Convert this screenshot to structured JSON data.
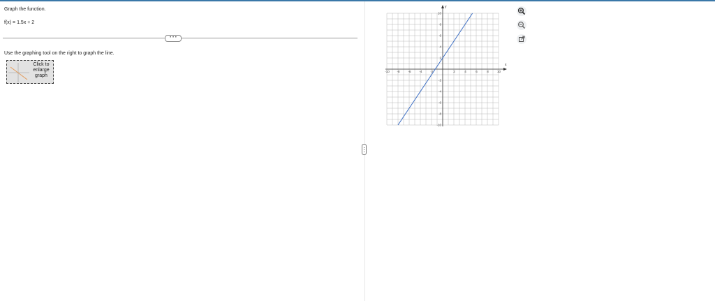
{
  "question": {
    "title": "Graph the function.",
    "function_text": "f(x) = 1.5x + 2",
    "instruction": "Use the graphing tool on the right to graph the line.",
    "enlarge_label_lines": [
      "Click to",
      "enlarge",
      "graph"
    ]
  },
  "graph": {
    "x_axis_label": "x",
    "y_axis_label": "y",
    "x_range": [
      -10,
      10
    ],
    "y_range": [
      -10,
      10
    ],
    "x_tick_labels": [
      "-10",
      "-8",
      "-6",
      "-4",
      "-2",
      "2",
      "4",
      "6",
      "8",
      "10"
    ],
    "y_tick_labels": [
      "10",
      "8",
      "6",
      "4",
      "2",
      "-2",
      "-4",
      "-6",
      "-8",
      "-10"
    ],
    "line": {
      "slope": 1.5,
      "intercept": 2
    },
    "line_color": "#3d6fc4"
  },
  "tools": [
    "zoom-in-icon",
    "zoom-out-icon",
    "popout-icon"
  ],
  "colors": {
    "accent": "#3a78a8",
    "grid": "#b8b8b8"
  }
}
